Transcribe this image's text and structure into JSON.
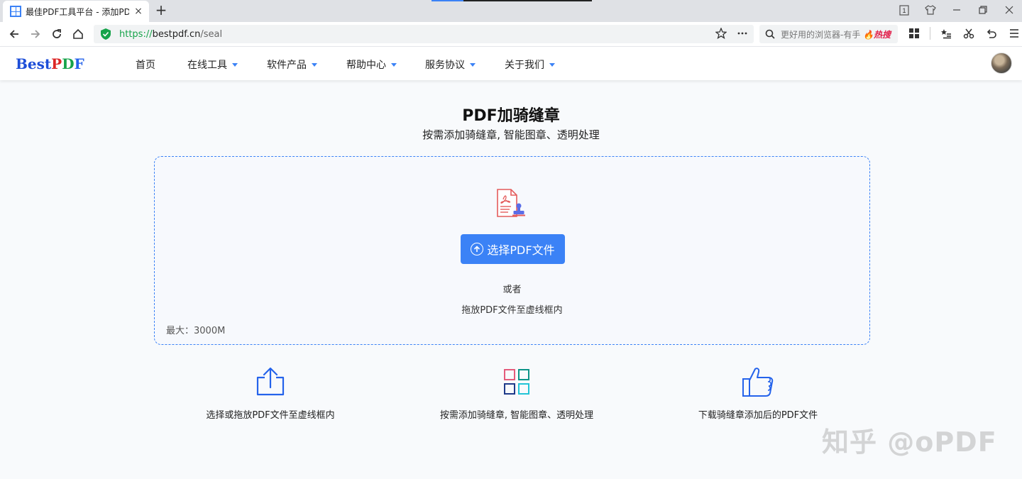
{
  "browser": {
    "tab_title": "最佳PDF工具平台 - 添加PDF骑缝章",
    "new_tab": "+",
    "tab_close": "×",
    "url_scheme": "https://",
    "url_host": "bestpdf.cn",
    "url_path": "/seal",
    "search_placeholder": "更好用的浏览器-有手",
    "search_hot": "🔥热搜",
    "tab_count": "1"
  },
  "site": {
    "logo_best": "Best",
    "logo_p": "P",
    "logo_d": "D",
    "logo_f": "F",
    "nav": [
      {
        "label": "首页",
        "has_dropdown": false
      },
      {
        "label": "在线工具",
        "has_dropdown": true
      },
      {
        "label": "软件产品",
        "has_dropdown": true
      },
      {
        "label": "帮助中心",
        "has_dropdown": true
      },
      {
        "label": "服务协议",
        "has_dropdown": true
      },
      {
        "label": "关于我们",
        "has_dropdown": true
      }
    ]
  },
  "main": {
    "title": "PDF加骑缝章",
    "subtitle": "按需添加骑缝章, 智能图章、透明处理",
    "upload": {
      "button_label": "选择PDF文件",
      "or_text": "或者",
      "drag_hint": "拖放PDF文件至虚线框内",
      "max_size": "最大：3000M"
    },
    "features": [
      {
        "icon": "upload-icon",
        "label": "选择或拖放PDF文件至虚线框内"
      },
      {
        "icon": "grid-icon",
        "label": "按需添加骑缝章, 智能图章、透明处理"
      },
      {
        "icon": "thumbs-up-icon",
        "label": "下载骑缝章添加后的PDF文件"
      }
    ]
  },
  "watermark": "知乎 @oPDF",
  "colors": {
    "accent": "#3b82f6",
    "secure_green": "#16a34a",
    "logo_red": "#dc2626",
    "logo_green": "#16a34a",
    "logo_blue": "#1d4ed8"
  }
}
